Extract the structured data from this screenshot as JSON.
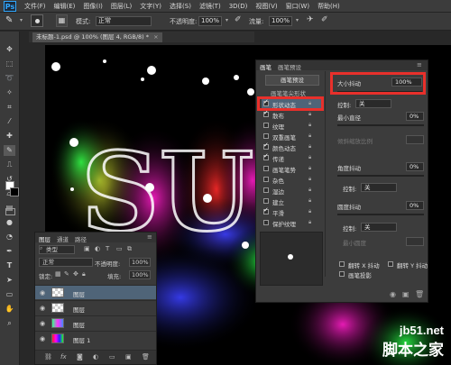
{
  "menubar": {
    "logo": "Ps",
    "items": [
      "文件(F)",
      "编辑(E)",
      "图像(I)",
      "图层(L)",
      "文字(Y)",
      "选择(S)",
      "滤镜(T)",
      "3D(D)",
      "视图(V)",
      "窗口(W)",
      "帮助(H)"
    ]
  },
  "optionsbar": {
    "mode_label": "模式:",
    "mode_value": "正常",
    "opacity_label": "不透明度:",
    "opacity_value": "100%",
    "flow_label": "流量:",
    "flow_value": "100%"
  },
  "document": {
    "tab_title": "未标题-1.psd @ 100% (图层 4, RGB/8) *"
  },
  "layers_panel": {
    "tabs": [
      "图层",
      "通道",
      "路径"
    ],
    "filter_label": "类型",
    "blend_mode": "正常",
    "opacity_label": "不透明度:",
    "opacity_value": "100%",
    "lock_label": "锁定:",
    "fill_label": "填充:",
    "fill_value": "100%",
    "layers": [
      {
        "name": "图层",
        "selected": true
      },
      {
        "name": "图层",
        "selected": false
      },
      {
        "name": "图层",
        "selected": false
      },
      {
        "name": "图层 1",
        "selected": false
      }
    ],
    "footer_icons": [
      "link-icon",
      "fx-icon",
      "mask-icon",
      "adjustment-icon",
      "folder-icon",
      "new-layer-icon",
      "trash-icon"
    ]
  },
  "brush_panel": {
    "tabs": [
      "画笔",
      "画笔预设"
    ],
    "preset_button": "画笔预设",
    "tip_label": "画笔笔尖形状",
    "options": [
      {
        "label": "形状动态",
        "checked": true
      },
      {
        "label": "散布",
        "checked": true
      },
      {
        "label": "纹理",
        "checked": false
      },
      {
        "label": "双重画笔",
        "checked": false
      },
      {
        "label": "颜色动态",
        "checked": true
      },
      {
        "label": "传递",
        "checked": true
      },
      {
        "label": "画笔笔势",
        "checked": false
      },
      {
        "label": "杂色",
        "checked": false
      },
      {
        "label": "湿边",
        "checked": false
      },
      {
        "label": "建立",
        "checked": false
      },
      {
        "label": "平滑",
        "checked": true
      },
      {
        "label": "保护纹理",
        "checked": false
      }
    ],
    "size_jitter_label": "大小抖动",
    "size_jitter_value": "100%",
    "control_label": "控制:",
    "control_value": "关",
    "min_diameter_label": "最小直径",
    "min_diameter_value": "0%",
    "tilt_scale_label": "倾斜缩放比例",
    "angle_jitter_label": "角度抖动",
    "angle_jitter_value": "0%",
    "control2_value": "关",
    "roundness_jitter_label": "圆度抖动",
    "roundness_jitter_value": "0%",
    "control3_value": "关",
    "min_roundness_label": "最小圆度",
    "flip_x_label": "翻转 X 抖动",
    "flip_y_label": "翻转 Y 抖动",
    "brush_projection_label": "画笔投影"
  },
  "canvas": {
    "art_text": "SUN"
  },
  "watermark": {
    "url": "jb51.net",
    "name": "脚本之家"
  },
  "colors": {
    "highlight": "#e8302b",
    "selected_layer": "#4f6478"
  }
}
